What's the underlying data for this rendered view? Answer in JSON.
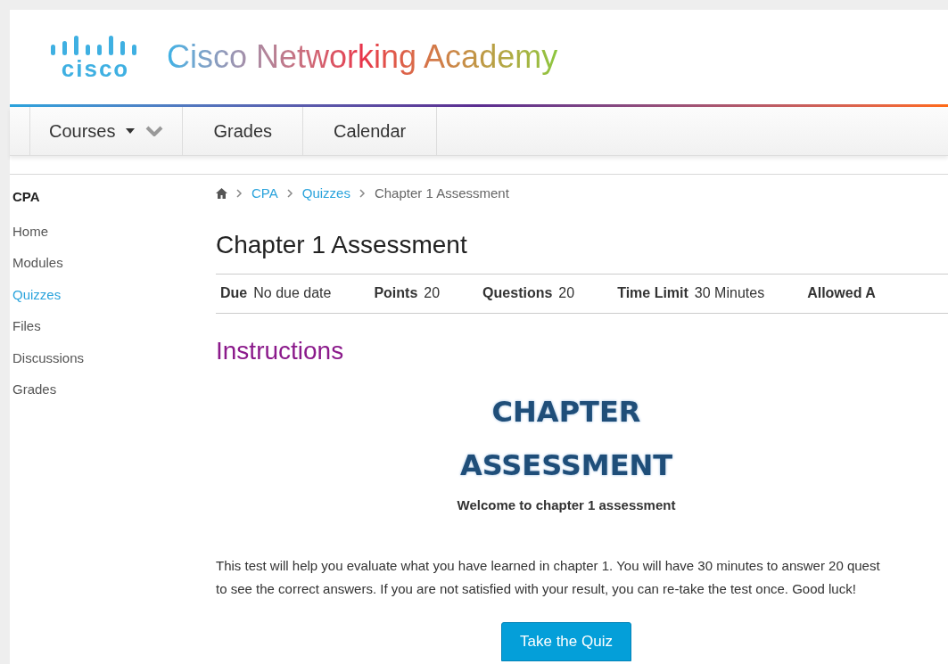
{
  "logo": {
    "wordmark": "cisco",
    "title": "Cisco Networking Academy"
  },
  "nav": [
    {
      "label": "Courses",
      "kind": "dropdown"
    },
    {
      "label": "Grades",
      "kind": "link"
    },
    {
      "label": "Calendar",
      "kind": "link"
    }
  ],
  "sidebar": {
    "title": "CPA",
    "items": [
      {
        "label": "Home",
        "selected": false
      },
      {
        "label": "Modules",
        "selected": false
      },
      {
        "label": "Quizzes",
        "selected": true
      },
      {
        "label": "Files",
        "selected": false
      },
      {
        "label": "Discussions",
        "selected": false
      },
      {
        "label": "Grades",
        "selected": false
      }
    ]
  },
  "breadcrumb": [
    {
      "label": "CPA",
      "kind": "link"
    },
    {
      "label": "Quizzes",
      "kind": "link"
    },
    {
      "label": "Chapter 1 Assessment",
      "kind": "current"
    }
  ],
  "page_title": "Chapter 1 Assessment",
  "details": [
    {
      "label": "Due",
      "value": "No due date"
    },
    {
      "label": "Points",
      "value": "20"
    },
    {
      "label": "Questions",
      "value": "20"
    },
    {
      "label": "Time Limit",
      "value": "30 Minutes"
    },
    {
      "label": "Allowed A"
    }
  ],
  "instructions_heading": "Instructions",
  "banner": [
    "CHAPTER",
    "ASSESSMENT"
  ],
  "welcome": "Welcome to chapter 1 assessment",
  "body_lines": [
    "This test will help you evaluate what you have learned in chapter 1. You will have 30 minutes to answer 20 quest",
    "to see the correct answers. If you are not satisfied with your result, you can re-take the test once. Good luck!"
  ],
  "button": "Take the Quiz"
}
